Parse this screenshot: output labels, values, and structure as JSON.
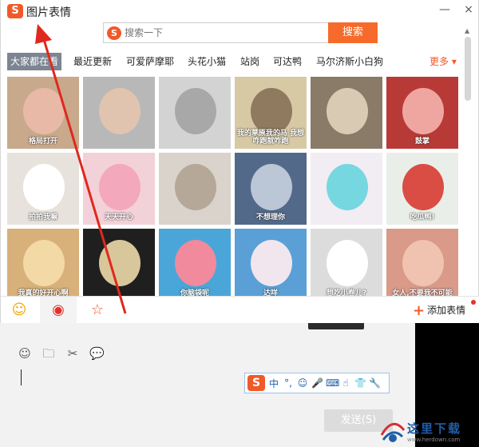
{
  "window": {
    "title": "图片表情",
    "logo": "S",
    "minimize": "—",
    "close": "×"
  },
  "search": {
    "placeholder": "搜索一下",
    "button": "搜索",
    "logo": "S"
  },
  "tabs": [
    {
      "label": "大家都在看",
      "active": true
    },
    {
      "label": "最近更新",
      "active": false
    },
    {
      "label": "可爱萨摩耶",
      "active": false
    },
    {
      "label": "头花小猫",
      "active": false
    },
    {
      "label": "站岗",
      "active": false
    },
    {
      "label": "可达鸭",
      "active": false
    },
    {
      "label": "马尔济斯小白狗",
      "active": false
    }
  ],
  "more": "更多 ▾",
  "stickers": [
    {
      "caption": "格局打开",
      "bg": "#c9a98b",
      "fg": "#e9b9a8"
    },
    {
      "caption": "",
      "bg": "#b8b8b8",
      "fg": "#e0c4b0"
    },
    {
      "caption": "",
      "bg": "#d3d3d3",
      "fg": "#a8a8a8"
    },
    {
      "caption": "我的草原我的马 我想咋跑就咋跑",
      "bg": "#d6c9a4",
      "fg": "#8f7a60"
    },
    {
      "caption": "",
      "bg": "#8a7a68",
      "fg": "#d9cbb3"
    },
    {
      "caption": "鼓掌",
      "bg": "#b83a37",
      "fg": "#f0a6a0"
    },
    {
      "caption": "拍拍我嘛",
      "bg": "#e8e2dc",
      "fg": "#ffffff"
    },
    {
      "caption": "天天开心",
      "bg": "#f3d1d8",
      "fg": "#f4a8bc"
    },
    {
      "caption": "",
      "bg": "#d9d3cc",
      "fg": "#b5a898"
    },
    {
      "caption": "不想理你",
      "bg": "#53698a",
      "fg": "#bbc6d6"
    },
    {
      "caption": "",
      "bg": "#f2ecf3",
      "fg": "#76d7e0"
    },
    {
      "caption": "吃瓜鸭!",
      "bg": "#e9efe8",
      "fg": "#d94d45"
    },
    {
      "caption": "我真的好开心啊",
      "bg": "#d8b07a",
      "fg": "#f2d9a6"
    },
    {
      "caption": "",
      "bg": "#1f1f1f",
      "fg": "#d8c79a"
    },
    {
      "caption": "你脑袋呢",
      "bg": "#4aa6d8",
      "fg": "#f08a9c"
    },
    {
      "caption": "达咩",
      "bg": "#5aa0d6",
      "fg": "#f1e6ee"
    },
    {
      "caption": "想吃小卷儿?",
      "bg": "#dcdcdc",
      "fg": "#ffffff"
    },
    {
      "caption": "女人,不要我不可能",
      "bg": "#d99a89",
      "fg": "#f0c2b0"
    }
  ],
  "bottom": {
    "emoji_icon": "☺",
    "sticker_icon": "◉",
    "star_icon": "☆",
    "add_label": "添加表情"
  },
  "chat": {
    "toolbar": [
      "☺",
      "🗀",
      "✂",
      "💬"
    ],
    "ime": [
      "中",
      "°,",
      "☺",
      "🎤",
      "⌨",
      "☝",
      "👕",
      "🔧"
    ],
    "send_label": "发送(S)"
  },
  "watermark": {
    "text": "这里下载",
    "url": "www.herdown.com"
  }
}
